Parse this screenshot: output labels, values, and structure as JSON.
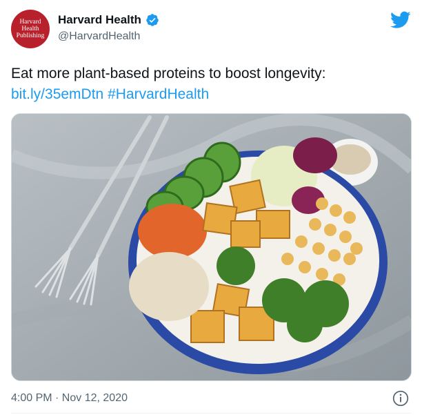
{
  "author": {
    "avatar_text": [
      "Harvard",
      "Health",
      "Publishing"
    ],
    "display_name": "Harvard Health",
    "handle": "@HarvardHealth",
    "verified": true,
    "avatar_color": "#b8212b"
  },
  "tweet": {
    "text": "Eat more plant-based proteins to boost longevity:",
    "link": "bit.ly/35emDtn",
    "hashtag": "#HarvardHealth",
    "link_color": "#1d9bf0"
  },
  "meta": {
    "timestamp": "4:00 PM · Nov 12, 2020"
  },
  "icons": {
    "brand": "twitter-bird-icon",
    "verified": "verified-badge-icon",
    "info": "info-icon"
  }
}
